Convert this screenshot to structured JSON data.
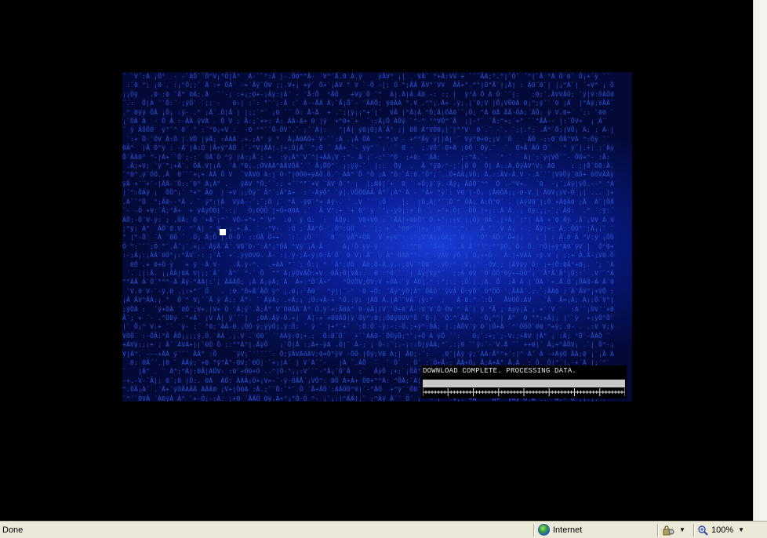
{
  "content": {
    "progress_label": "DOWNLOAD COMPLETE. PROCESSING DATA.",
    "progress_fraction": 1.0
  },
  "statusbar": {
    "status_text": "Done",
    "zone_label": "Internet",
    "zone_icon": "globe-icon",
    "security_icon": "lock-gear-icon",
    "zoom_label": "100%",
    "zoom_icon": "magnifier-icon"
  },
  "colors": {
    "background": "#000000",
    "stage_center": "#1a3cd6",
    "stage_edge": "#030a38",
    "matrix_text": "#2a56d8",
    "statusbar_bg": "#ece9d8"
  }
}
